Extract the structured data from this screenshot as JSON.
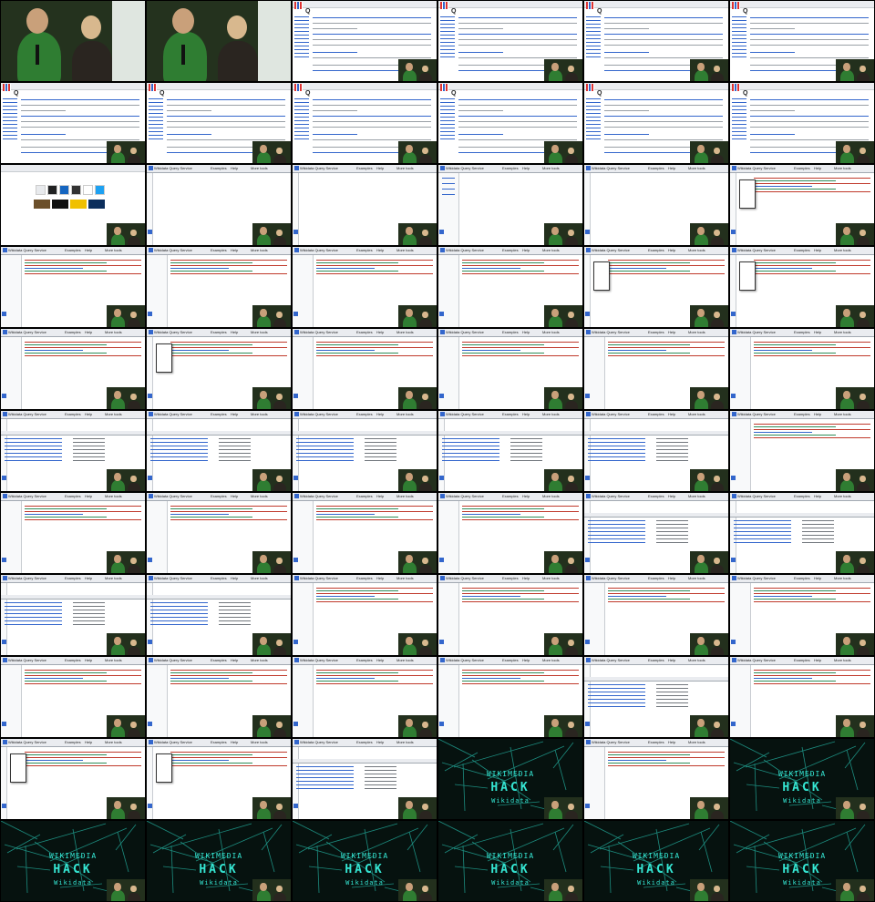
{
  "page": {
    "title": "",
    "grid_columns": 6,
    "grid_rows": 11
  },
  "wiki": {
    "logo_text": "Wikipedia",
    "item_title": "Q",
    "search_placeholder": ""
  },
  "query_service": {
    "header_title": "Wikidata Query Service",
    "tabs": [
      "Examples",
      "Help",
      "More tools"
    ],
    "run_button": "▶"
  },
  "slide": {
    "line1": "WIKIMEDIA",
    "line2": "HACK",
    "line3": "Wikidata"
  },
  "colors": {
    "link": "#3366cc",
    "wiki_text": "#202122",
    "slide_cyan": "#35e6d3",
    "stage_green": "#24321e",
    "shirt_green": "#2f7d32",
    "code_red": "#c0392b"
  },
  "cells": [
    {
      "type": "stage"
    },
    {
      "type": "stage"
    },
    {
      "type": "wiki"
    },
    {
      "type": "wiki"
    },
    {
      "type": "wiki"
    },
    {
      "type": "wiki"
    },
    {
      "type": "wiki"
    },
    {
      "type": "wiki"
    },
    {
      "type": "wiki"
    },
    {
      "type": "wiki"
    },
    {
      "type": "wiki"
    },
    {
      "type": "wiki"
    },
    {
      "type": "browser-newtab"
    },
    {
      "type": "query-empty"
    },
    {
      "type": "query-empty"
    },
    {
      "type": "query-sidebar"
    },
    {
      "type": "query-empty"
    },
    {
      "type": "query-popup"
    },
    {
      "type": "query-code"
    },
    {
      "type": "query-code"
    },
    {
      "type": "query-code"
    },
    {
      "type": "query-code"
    },
    {
      "type": "query-popup"
    },
    {
      "type": "query-popup"
    },
    {
      "type": "query-code"
    },
    {
      "type": "query-popup"
    },
    {
      "type": "query-code"
    },
    {
      "type": "query-code"
    },
    {
      "type": "query-code"
    },
    {
      "type": "query-code"
    },
    {
      "type": "query-result"
    },
    {
      "type": "query-result"
    },
    {
      "type": "query-result"
    },
    {
      "type": "query-result"
    },
    {
      "type": "query-result"
    },
    {
      "type": "query-code"
    },
    {
      "type": "query-code"
    },
    {
      "type": "query-code"
    },
    {
      "type": "query-code"
    },
    {
      "type": "query-code"
    },
    {
      "type": "query-result"
    },
    {
      "type": "query-result"
    },
    {
      "type": "query-result"
    },
    {
      "type": "query-result"
    },
    {
      "type": "query-code"
    },
    {
      "type": "query-code"
    },
    {
      "type": "query-code"
    },
    {
      "type": "query-code"
    },
    {
      "type": "query-code"
    },
    {
      "type": "query-code"
    },
    {
      "type": "query-code"
    },
    {
      "type": "query-code"
    },
    {
      "type": "query-result"
    },
    {
      "type": "query-code"
    },
    {
      "type": "query-popup"
    },
    {
      "type": "query-popup"
    },
    {
      "type": "query-result"
    },
    {
      "type": "dark"
    },
    {
      "type": "query-code"
    },
    {
      "type": "dark"
    },
    {
      "type": "dark"
    },
    {
      "type": "dark"
    },
    {
      "type": "dark"
    },
    {
      "type": "dark"
    },
    {
      "type": "dark"
    },
    {
      "type": "dark"
    }
  ]
}
